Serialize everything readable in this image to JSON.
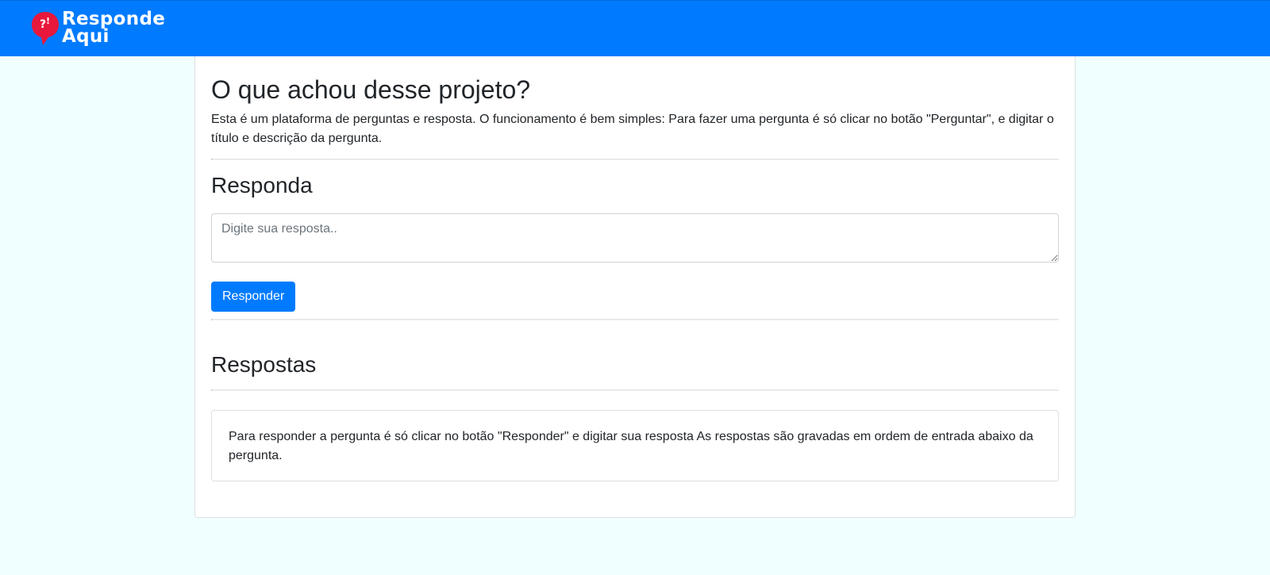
{
  "navbar": {
    "brand_line1": "Responde",
    "brand_line2": "Aqui",
    "logo_icon": "question-speech-bubble-icon",
    "background_color": "#007bff",
    "logo_color": "#e8173c"
  },
  "question": {
    "title": "O que achou desse projeto?",
    "description": "Esta é um plataforma de perguntas e resposta. O funcionamento é bem simples: Para fazer uma pergunta é só clicar no botão \"Perguntar\", e digitar o título e descrição da pergunta."
  },
  "answer_form": {
    "heading": "Responda",
    "placeholder": "Digite sua resposta..",
    "value": "",
    "submit_label": "Responder"
  },
  "answers": {
    "heading": "Respostas",
    "items": [
      {
        "text": "Para responder a pergunta é só clicar no botão \"Responder\" e digitar sua resposta As respostas são gravadas em ordem de entrada abaixo da pergunta."
      }
    ]
  },
  "colors": {
    "page_background": "#f0ffff",
    "primary": "#007bff",
    "text": "#212529"
  }
}
